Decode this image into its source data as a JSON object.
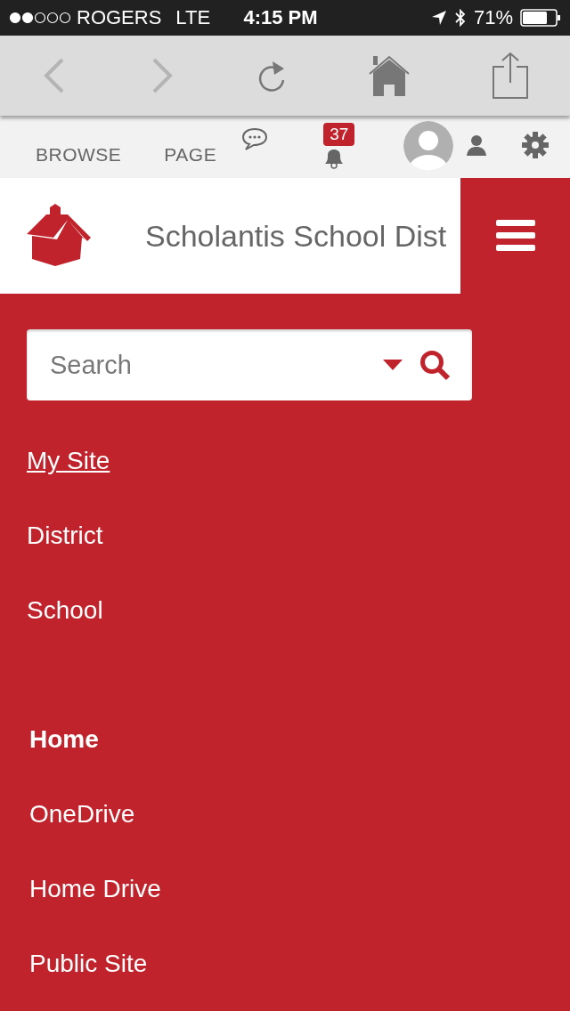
{
  "status_bar": {
    "carrier": "ROGERS",
    "network": "LTE",
    "time": "4:15 PM",
    "battery": "71%"
  },
  "ribbon": {
    "tabs": [
      {
        "label": "BROWSE"
      },
      {
        "label": "PAGE"
      }
    ],
    "notifications": "37"
  },
  "header": {
    "title": "Scholantis School Dist"
  },
  "search": {
    "placeholder": "Search"
  },
  "menu_groups": [
    {
      "kind": "sites",
      "items": [
        {
          "label": "My Site",
          "selected": true
        },
        {
          "label": "District",
          "selected": false
        },
        {
          "label": "School",
          "selected": false
        }
      ]
    },
    {
      "kind": "pages",
      "items": [
        {
          "label": "Home",
          "selected": true
        },
        {
          "label": "OneDrive",
          "selected": false
        },
        {
          "label": "Home Drive",
          "selected": false
        },
        {
          "label": "Public Site",
          "selected": false
        }
      ]
    }
  ]
}
